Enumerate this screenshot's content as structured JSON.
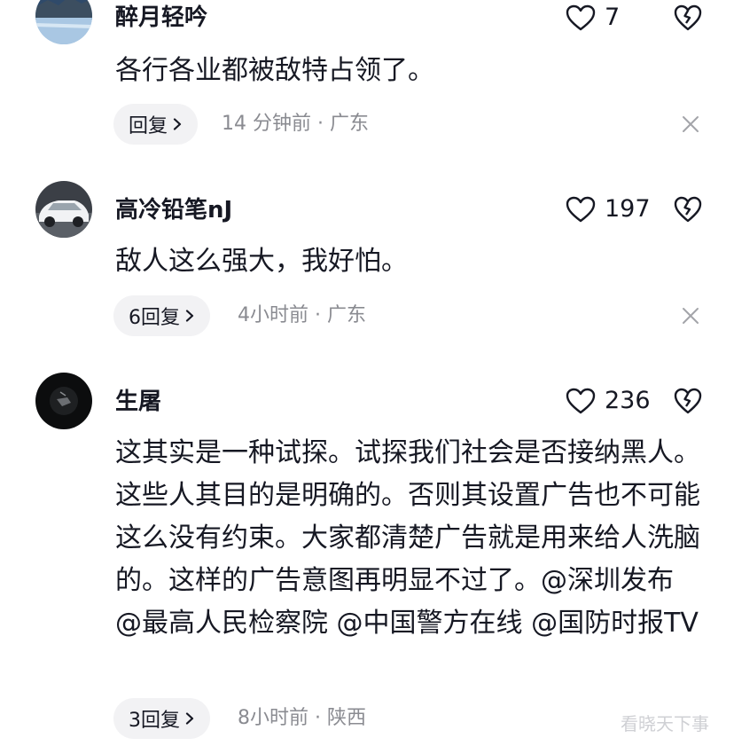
{
  "comments": [
    {
      "username": "醉月轻吟",
      "likes": "7",
      "text": "各行各业都被敌特占领了。",
      "reply_label": "回复",
      "meta": "14 分钟前 · 广东"
    },
    {
      "username": "高冷铅笔nJ",
      "likes": "197",
      "text": "敌人这么强大，我好怕。",
      "reply_label": "6回复",
      "meta": "4小时前 · 广东"
    },
    {
      "username": "生屠",
      "likes": "236",
      "text": "这其实是一种试探。试探我们社会是否接纳黑人。这些人其目的是明确的。否则其设置广告也不可能这么没有约束。大家都清楚广告就是用来给人洗脑的。这样的广告意图再明显不过了。@深圳发布 @最高人民检察院 @中国警方在线 @国防时报TV",
      "reply_label": "3回复",
      "meta": "8小时前 · 陕西"
    }
  ],
  "watermark": "看晓天下事",
  "icons": {
    "like": "heart-outline-icon",
    "dislike": "broken-heart-icon",
    "close": "close-icon",
    "chevron": "chevron-right-icon"
  },
  "colors": {
    "text": "#161823",
    "meta": "#8a8b91",
    "pill_bg": "#f2f2f4"
  }
}
